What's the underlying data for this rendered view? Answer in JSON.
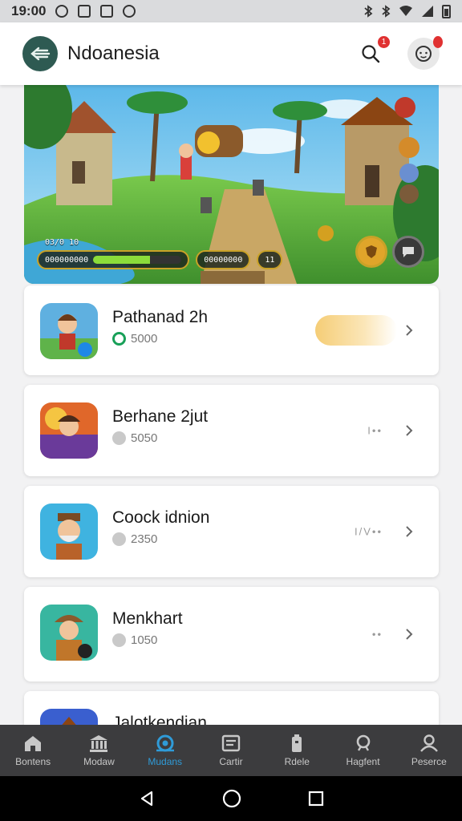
{
  "status_bar": {
    "time": "19:00"
  },
  "header": {
    "title": "Ndoanesia",
    "search_badge": "1",
    "profile_badge": ""
  },
  "banner": {
    "hud_stats": "03/0 10",
    "hud_label": "000000000",
    "hud_level": 0.64,
    "hud_resources": "00000000",
    "hud_coins": "11"
  },
  "games": [
    {
      "title": "Pathanad 2h",
      "value": "5000",
      "coin": "green",
      "extra": ""
    },
    {
      "title": "Berhane 2jut",
      "value": "5050",
      "coin": "grey",
      "extra": "I••"
    },
    {
      "title": "Coock idnion",
      "value": "2350",
      "coin": "grey",
      "extra": "I/V••"
    },
    {
      "title": "Menkhart",
      "value": "1050",
      "coin": "grey",
      "extra": "••"
    },
    {
      "title": "Jalotkendian",
      "value": "",
      "coin": "grey",
      "extra": ""
    }
  ],
  "bottom_nav": [
    {
      "label": "Bontens",
      "icon": "home-icon",
      "active": false
    },
    {
      "label": "Modaw",
      "icon": "bank-icon",
      "active": false
    },
    {
      "label": "Mudans",
      "icon": "games-icon",
      "active": true
    },
    {
      "label": "Cartir",
      "icon": "wallet-icon",
      "active": false
    },
    {
      "label": "Rdele",
      "icon": "battery-icon",
      "active": false
    },
    {
      "label": "Hagfent",
      "icon": "search-icon",
      "active": false
    },
    {
      "label": "Peserce",
      "icon": "person-icon",
      "active": false
    }
  ],
  "colors": {
    "accent": "#2f9bd8",
    "logo_bg": "#2e5a52",
    "badge": "#e03131",
    "nav_bg": "#3c3c3e"
  }
}
